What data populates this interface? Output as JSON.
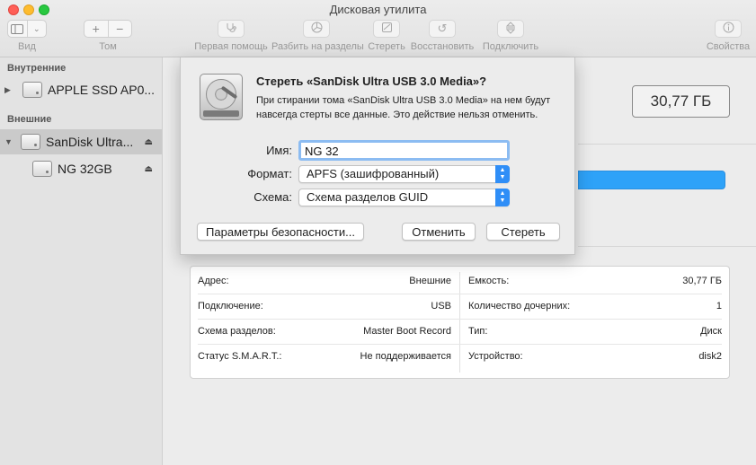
{
  "window": {
    "title": "Дисковая утилита"
  },
  "toolbar": {
    "view_label": "Вид",
    "volume_label": "Том",
    "first_aid_label": "Первая помощь",
    "partition_label": "Разбить на разделы",
    "erase_label": "Стереть",
    "restore_label": "Восстановить",
    "mount_label": "Подключить",
    "info_label": "Свойства"
  },
  "sidebar": {
    "internal_header": "Внутренние",
    "external_header": "Внешние",
    "items": [
      {
        "label": "APPLE SSD AP0...",
        "expanded": false
      },
      {
        "label": "SanDisk Ultra...",
        "expanded": true,
        "selected": true
      },
      {
        "label": "NG 32GB"
      }
    ]
  },
  "main": {
    "capacity": "30,77 ГБ",
    "usage_color": "#2ea2f8"
  },
  "info": {
    "rows": [
      {
        "k1": "Адрес:",
        "v1": "Внешние",
        "k2": "Емкость:",
        "v2": "30,77 ГБ"
      },
      {
        "k1": "Подключение:",
        "v1": "USB",
        "k2": "Количество дочерних:",
        "v2": "1"
      },
      {
        "k1": "Схема разделов:",
        "v1": "Master Boot Record",
        "k2": "Тип:",
        "v2": "Диск"
      },
      {
        "k1": "Статус S.M.A.R.T.:",
        "v1": "Не поддерживается",
        "k2": "Устройство:",
        "v2": "disk2"
      }
    ]
  },
  "sheet": {
    "title": "Стереть «SanDisk Ultra USB 3.0 Media»?",
    "message": "При стирании тома «SanDisk Ultra USB 3.0 Media» на нем будут навсегда стерты все данные. Это действие нельзя отменить.",
    "name_label": "Имя:",
    "name_value": "NG 32",
    "format_label": "Формат:",
    "format_value": "APFS (зашифрованный)",
    "scheme_label": "Схема:",
    "scheme_value": "Схема разделов GUID",
    "security_button": "Параметры безопасности...",
    "cancel_button": "Отменить",
    "erase_button": "Стереть",
    "accent_color": "#2f8ef7"
  }
}
